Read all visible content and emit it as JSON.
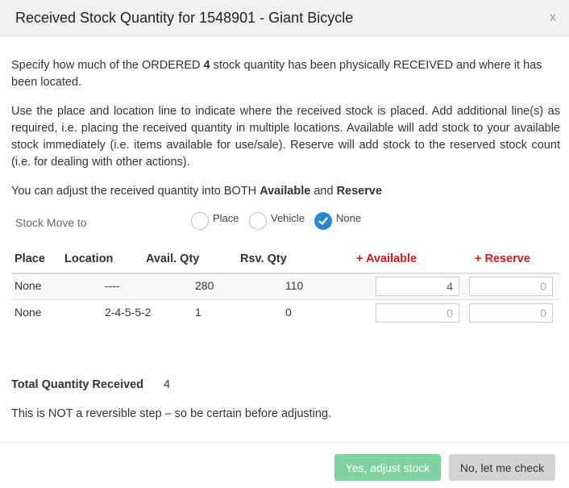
{
  "dialog": {
    "title": "Received Stock Quantity for 1548901 - Giant Bicycle",
    "close_label": "x"
  },
  "intro": {
    "p1_before": "Specify how much of the ORDERED ",
    "p1_qty": "4",
    "p1_after": " stock quantity has been physically RECEIVED and where it has been located.",
    "p2": "Use the place and location line to indicate where the received stock is placed. Add additional line(s) as required, i.e. placing the received quantity in multiple locations. Available will add stock to your available stock immediately (i.e. items available for use/sale). Reserve will add stock to the reserved stock count (i.e. for dealing with other actions).",
    "p3_before": "You can adjust the received quantity into BOTH ",
    "p3_available": "Available",
    "p3_and": " and ",
    "p3_reserve": "Reserve"
  },
  "stock_move": {
    "label": "Stock Move to",
    "options": [
      {
        "label": "Place",
        "checked": false
      },
      {
        "label": "Vehicle",
        "checked": false
      },
      {
        "label": "None",
        "checked": true
      }
    ]
  },
  "table": {
    "headers": {
      "place": "Place",
      "location": "Location",
      "avail_qty": "Avail. Qty",
      "rsv_qty": "Rsv. Qty",
      "plus_available": "+ Available",
      "plus_reserve": "+ Reserve"
    },
    "rows": [
      {
        "place": "None",
        "location": "----",
        "avail_qty": "280",
        "rsv_qty": "110",
        "add_available": "4",
        "add_available_placeholder": "0",
        "add_reserve": "",
        "add_reserve_placeholder": "0"
      },
      {
        "place": "None",
        "location": "2-4-5-5-2",
        "avail_qty": "1",
        "rsv_qty": "0",
        "add_available": "",
        "add_available_placeholder": "0",
        "add_reserve": "",
        "add_reserve_placeholder": "0"
      }
    ]
  },
  "summary": {
    "total_label": "Total Quantity Received",
    "total_value": "4",
    "warning": "This is NOT a reversible step – so be certain before adjusting."
  },
  "footer": {
    "confirm_label": "Yes, adjust stock",
    "cancel_label": "No, let me check"
  },
  "colors": {
    "header_bg": "#f0f0f0",
    "accent_red": "#cc1f1f",
    "radio_checked": "#2e86d1",
    "confirm_bg": "#7fd1a0",
    "cancel_bg": "#d3d3d3"
  }
}
